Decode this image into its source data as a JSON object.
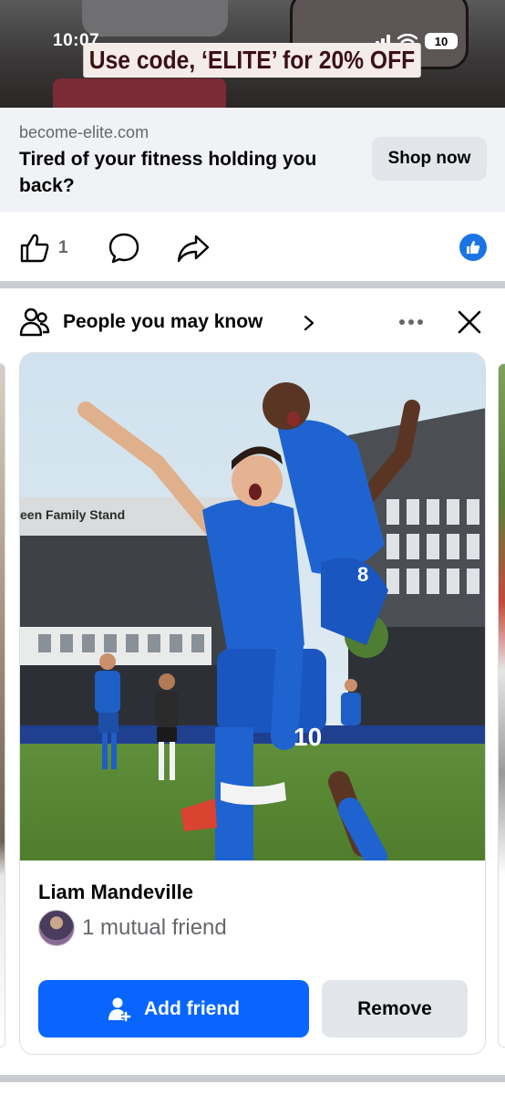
{
  "status_bar": {
    "time": "10:07",
    "battery": "10"
  },
  "ad": {
    "promo_text": "Use code, ‘ELITE’ for 20% OFF",
    "domain": "become-elite.com",
    "headline": "Tired of your fitness holding you back?",
    "cta_label": "Shop now"
  },
  "actions": {
    "like_count": "1"
  },
  "pymk": {
    "title": "People you may know",
    "card": {
      "name": "Liam Mandeville",
      "mutual": "1 mutual friend",
      "add_label": "Add friend",
      "remove_label": "Remove"
    }
  },
  "colors": {
    "primary_blue": "#0866ff",
    "secondary_text": "#65676b",
    "button_gray": "#e2e5e9"
  }
}
